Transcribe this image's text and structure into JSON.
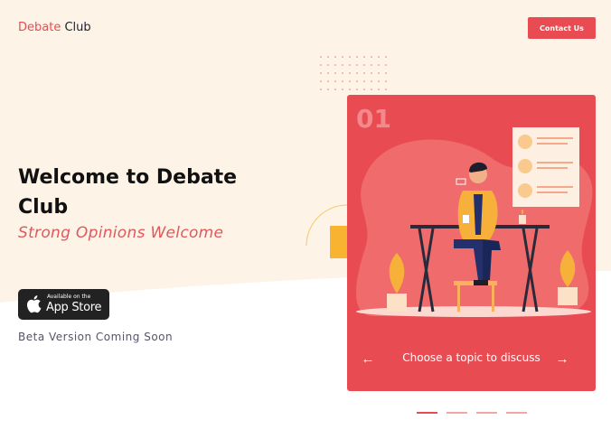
{
  "header": {
    "brand_primary": "Debate",
    "brand_secondary": " Club",
    "contact_label": "Contact Us"
  },
  "hero": {
    "title": "Welcome to Debate Club",
    "subtitle": "Strong Opinions Welcome",
    "app_store_small": "Available on the",
    "app_store_big": "App Store",
    "beta_note": "Beta Version Coming Soon"
  },
  "carousel": {
    "slide_number": "01",
    "caption": "Choose a topic to discuss",
    "prev_icon": "arrow-left-icon",
    "next_icon": "arrow-right-icon",
    "slide_count": 4,
    "active_index": 0
  },
  "colors": {
    "accent": "#e84c52",
    "background_tint": "#fdf3e6"
  }
}
